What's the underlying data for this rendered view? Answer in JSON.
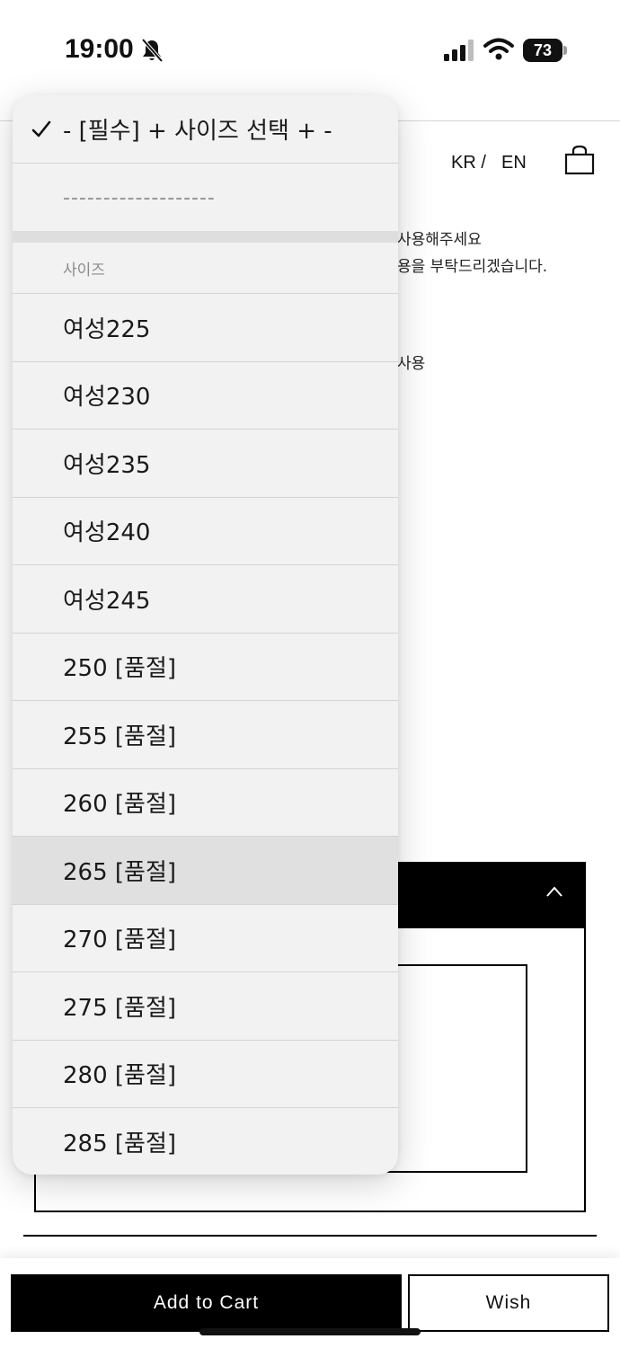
{
  "status_bar": {
    "time": "19:00",
    "battery": "73"
  },
  "header": {
    "lang_kr": "KR /",
    "lang_en": "EN"
  },
  "notice": {
    "line1": "사용해주세요",
    "line2": "용을 부탁드리겠습니다.",
    "line3": "사용"
  },
  "dropdown": {
    "selected": "- [필수] + 사이즈 선택 + -",
    "separator": "-------------------",
    "group_label": "사이즈",
    "options": [
      "여성225",
      "여성230",
      "여성235",
      "여성240",
      "여성245",
      "250 [품절]",
      "255 [품절]",
      "260 [품절]",
      "265 [품절]",
      "270 [품절]",
      "275 [품절]",
      "280 [품절]",
      "285 [품절]"
    ]
  },
  "actions": {
    "add_to_cart": "Add to Cart",
    "wish": "Wish"
  }
}
